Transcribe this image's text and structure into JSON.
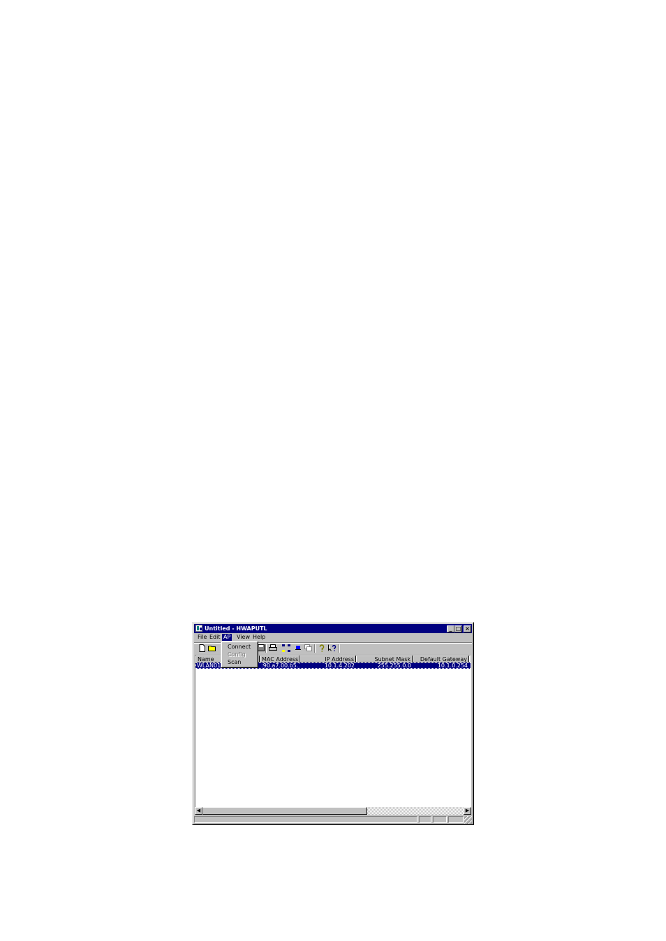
{
  "window": {
    "title": "Untitled - HWAPUTL",
    "controls": {
      "minimize": "_",
      "maximize": "□",
      "close": "×"
    }
  },
  "menubar": {
    "items": [
      "File",
      "Edit",
      "AP",
      "View",
      "Help"
    ],
    "active": "AP"
  },
  "ap_menu": {
    "items": [
      {
        "label": "Connect",
        "enabled": true
      },
      {
        "label": "Config",
        "enabled": false
      },
      {
        "label": "Scan",
        "enabled": true
      }
    ]
  },
  "toolbar": {
    "icons": [
      "new-file-icon",
      "open-folder-icon",
      "save-icon",
      "print-icon",
      "network-icon",
      "single-ap-icon",
      "window-icon",
      "help-icon",
      "context-help-icon"
    ]
  },
  "list": {
    "columns": [
      "Name",
      "MAC Address",
      "IP Address",
      "Subnet Mask",
      "Default Gateway"
    ],
    "rows": [
      {
        "name": "WLAN01",
        "mac": ":90.a7.00.b5.1d",
        "ip": "10.1.4.202",
        "mask": "255.255.0.0",
        "gateway": "10.1.0.254",
        "selected": true
      }
    ]
  },
  "colors": {
    "title_bar": "#000080",
    "selection": "#000080",
    "face": "#c0c0c0"
  }
}
